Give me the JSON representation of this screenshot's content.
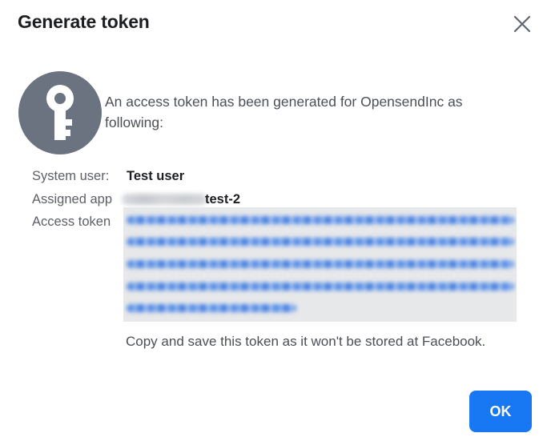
{
  "dialog": {
    "title": "Generate token",
    "close_icon": "close-icon",
    "avatar_icon": "key-icon",
    "message": "An access token has been generated for OpensendInc as following:",
    "system_user": {
      "label": "System user:",
      "value": "Test user"
    },
    "assigned_app": {
      "label": "Assigned app",
      "value_visible": "test-2"
    },
    "access_token": {
      "label": "Access token",
      "value": ""
    },
    "note": "Copy and save this token as it won't be stored at Facebook.",
    "ok_label": "OK",
    "colors": {
      "primary": "#1877f2",
      "avatar_bg": "#6b7280",
      "token_bg": "#e7e8ea",
      "blur_text": "#3f7fe6"
    }
  }
}
